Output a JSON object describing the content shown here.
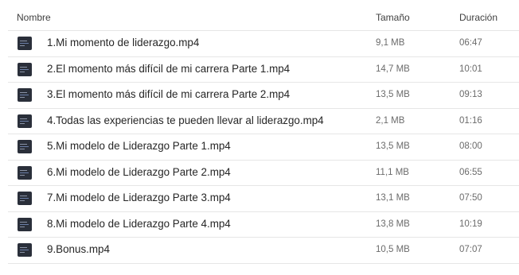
{
  "header": {
    "name": "Nombre",
    "size": "Tamaño",
    "duration": "Duración"
  },
  "files": [
    {
      "name": "1.Mi momento de liderazgo.mp4",
      "size": "9,1 MB",
      "duration": "06:47",
      "icon": "video-thumbnail-icon"
    },
    {
      "name": "2.El momento más difícil de mi carrera Parte 1.mp4",
      "size": "14,7 MB",
      "duration": "10:01",
      "icon": "video-thumbnail-icon"
    },
    {
      "name": "3.El momento más difícil de mi carrera Parte 2.mp4",
      "size": "13,5 MB",
      "duration": "09:13",
      "icon": "video-thumbnail-icon"
    },
    {
      "name": "4.Todas las experiencias te pueden llevar al liderazgo.mp4",
      "size": "2,1 MB",
      "duration": "01:16",
      "icon": "video-thumbnail-icon"
    },
    {
      "name": "5.Mi modelo de Liderazgo Parte 1.mp4",
      "size": "13,5 MB",
      "duration": "08:00",
      "icon": "video-thumbnail-icon"
    },
    {
      "name": "6.Mi modelo de Liderazgo Parte 2.mp4",
      "size": "11,1 MB",
      "duration": "06:55",
      "icon": "video-thumbnail-icon"
    },
    {
      "name": "7.Mi modelo de Liderazgo Parte 3.mp4",
      "size": "13,1 MB",
      "duration": "07:50",
      "icon": "video-thumbnail-icon"
    },
    {
      "name": "8.Mi modelo de Liderazgo Parte 4.mp4",
      "size": "13,8 MB",
      "duration": "10:19",
      "icon": "video-thumbnail-icon"
    },
    {
      "name": "9.Bonus.mp4",
      "size": "10,5 MB",
      "duration": "07:07",
      "icon": "video-thumbnail-icon"
    }
  ]
}
